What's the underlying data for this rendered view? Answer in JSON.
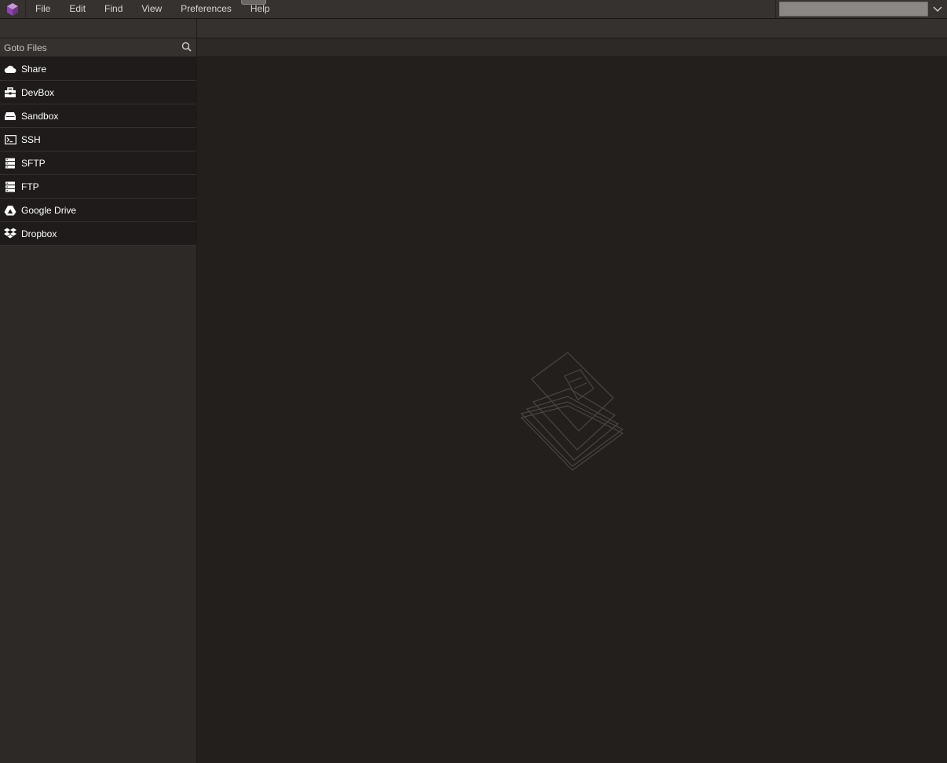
{
  "menu": {
    "items": [
      "File",
      "Edit",
      "Find",
      "View",
      "Preferences",
      "Help"
    ]
  },
  "sidebar": {
    "goto_label": "Goto Files",
    "items": [
      {
        "label": "Share",
        "icon": "cloud-icon"
      },
      {
        "label": "DevBox",
        "icon": "toolbox-icon"
      },
      {
        "label": "Sandbox",
        "icon": "drive-icon"
      },
      {
        "label": "SSH",
        "icon": "terminal-icon"
      },
      {
        "label": "SFTP",
        "icon": "server-icon"
      },
      {
        "label": "FTP",
        "icon": "server-icon"
      },
      {
        "label": "Google Drive",
        "icon": "google-drive-icon"
      },
      {
        "label": "Dropbox",
        "icon": "dropbox-icon"
      }
    ]
  },
  "colors": {
    "accent_logo": "#9b59b6",
    "background": "#221f1d",
    "sidebar": "#2c2926",
    "menubar": "#36322f"
  }
}
